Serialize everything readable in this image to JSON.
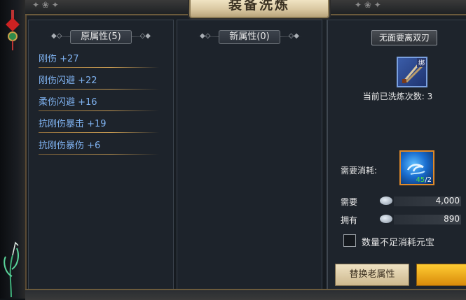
{
  "window": {
    "title": "装备洗炼"
  },
  "old_panel": {
    "header": "原属性(5)",
    "attributes": [
      "刚伤 +27",
      "刚伤闪避 +22",
      "柔伤闪避 +16",
      "抗刚伤暴击 +19",
      "抗刚伤暴伤 +6"
    ]
  },
  "new_panel": {
    "header": "新属性(0)"
  },
  "equip": {
    "name": "无面要离双刃",
    "badge": "绑",
    "wash_count": "当前已洗炼次数: 3"
  },
  "cost": {
    "label": "需要消耗:",
    "gem_have": "45",
    "gem_need": "/2",
    "need_label": "需要",
    "need_value": "4,000",
    "own_label": "拥有",
    "own_value": "890"
  },
  "options": {
    "checkbox_label": "数量不足消耗元宝",
    "checked": false
  },
  "buttons": {
    "replace_label": "替换老属性"
  },
  "colors": {
    "attr_text": "#7fb2f0",
    "gold": "#d98b0a",
    "gem_count": "#4be04b"
  }
}
